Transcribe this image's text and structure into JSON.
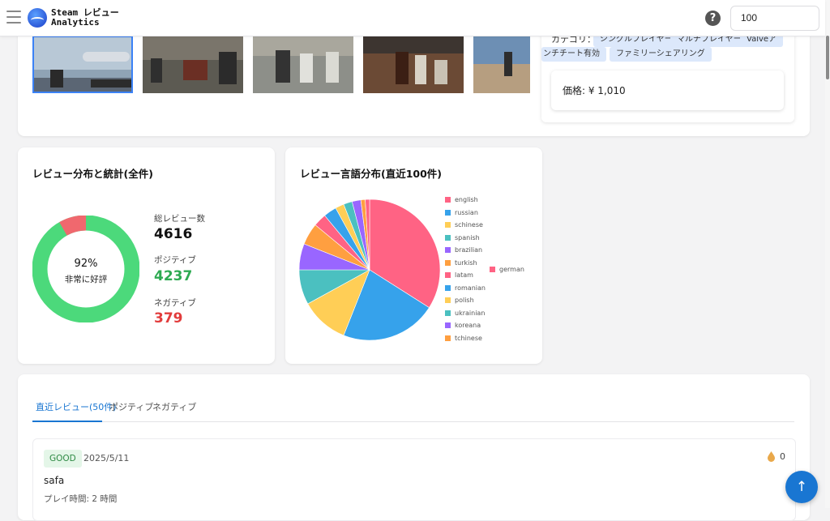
{
  "header": {
    "brand_line1": "Steam レビュー",
    "brand_line2": "Analytics",
    "help_label": "?",
    "search_value": "100"
  },
  "game_info": {
    "screenshots": [
      "screenshot-1",
      "screenshot-2",
      "screenshot-3",
      "screenshot-4",
      "screenshot-5"
    ],
    "category_label": "カテゴリ：",
    "tags": [
      "シングルプレイヤー",
      "マルチプレイヤー",
      "Valveア",
      "ンチチート有効",
      "ファミリーシェアリング"
    ],
    "price": "価格: ¥ 1,010"
  },
  "stats_card": {
    "title": "レビュー分布と統計(全件)",
    "donut_percent": "92%",
    "donut_label": "非常に好評",
    "total_label": "総レビュー数",
    "total_value": "4616",
    "positive_label": "ポジティブ",
    "positive_value": "4237",
    "negative_label": "ネガティブ",
    "negative_value": "379",
    "positive_color": "#4cd97b",
    "negative_color": "#f0686e"
  },
  "chart_data": {
    "type": "pie",
    "title": "レビュー言語分布(直近100件)",
    "labels": [
      "english",
      "russian",
      "schinese",
      "spanish",
      "brazilian",
      "turkish",
      "latam",
      "romanian",
      "polish",
      "ukrainian",
      "koreana",
      "tchinese",
      "german"
    ],
    "values": [
      34,
      22,
      11,
      8,
      6,
      5,
      3,
      3,
      2,
      2,
      2,
      1,
      1
    ],
    "colors": [
      "#ff6384",
      "#36a2eb",
      "#ffce56",
      "#4bc0c0",
      "#9966ff",
      "#ff9f40",
      "#ff6384",
      "#36a2eb",
      "#ffce56",
      "#4bc0c0",
      "#9966ff",
      "#ff9f40",
      "#ff6384"
    ],
    "legend_position": "right"
  },
  "reviews": {
    "tabs": [
      "直近レビュー(50件)",
      "ポジティブ",
      "ネガティブ"
    ],
    "active_tab": 0,
    "items": [
      {
        "badge": "GOOD",
        "date": "2025/5/11",
        "text": "safa",
        "playtime": "プレイ時間: 2 時間",
        "likes": "0"
      }
    ]
  },
  "fab_icon": "arrow-up-icon"
}
